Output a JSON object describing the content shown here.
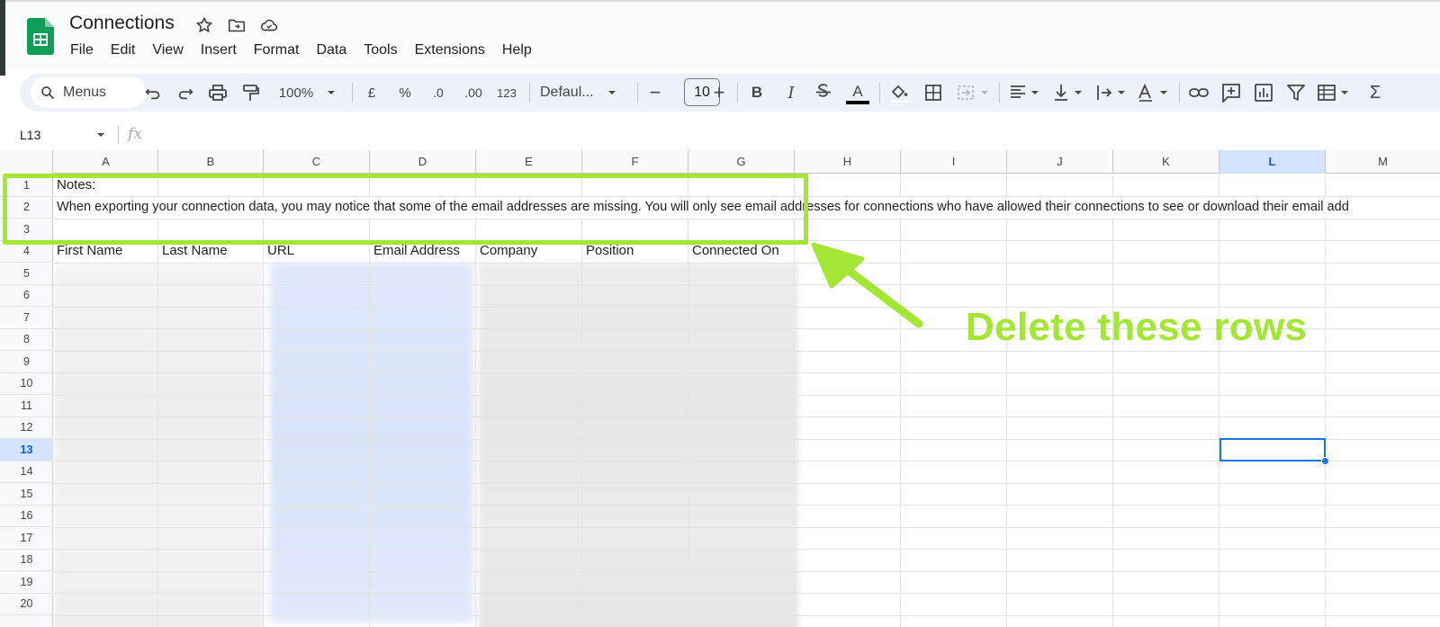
{
  "app": {
    "doc_title": "Connections",
    "icons": [
      "sheets-logo-icon",
      "star-icon",
      "move-folder-icon",
      "cloud-saved-icon"
    ]
  },
  "menu": [
    "File",
    "Edit",
    "View",
    "Insert",
    "Format",
    "Data",
    "Tools",
    "Extensions",
    "Help"
  ],
  "toolbar": {
    "search_label": "Menus",
    "zoom": "100%",
    "currency": "£",
    "percent": "%",
    "decrease_decimal": ".0",
    "increase_decimal": ".00",
    "number_format": "123",
    "font": "Defaul...",
    "font_size": "10",
    "minus": "−",
    "plus": "+",
    "bold": "B",
    "italic": "I",
    "text_color_letter": "A",
    "sum": "Σ"
  },
  "formula_bar": {
    "name_box": "L13",
    "fx": "fx"
  },
  "sheet": {
    "columns": [
      "A",
      "B",
      "C",
      "D",
      "E",
      "F",
      "G",
      "H",
      "I",
      "J",
      "K",
      "L",
      "M"
    ],
    "selected_column": "L",
    "rows": [
      "1",
      "2",
      "3",
      "4",
      "5",
      "6",
      "7",
      "8",
      "9",
      "10",
      "11",
      "12",
      "13",
      "14",
      "15",
      "16",
      "17",
      "18",
      "19",
      "20"
    ],
    "selected_row": "13",
    "notes_label": "Notes:",
    "notes_text": "When exporting your connection data, you may notice that some of the email addresses are missing. You will only see email addresses for connections who have allowed their connections to see or download their email add",
    "headers": [
      "First Name",
      "Last Name",
      "URL",
      "Email Address",
      "Company",
      "Position",
      "Connected On"
    ]
  },
  "annotation": {
    "text": "Delete these rows",
    "color": "#a3e635"
  },
  "colors": {
    "accent": "#1a73e8",
    "sheets_green": "#0f9d58",
    "annotation_green": "#a3e635"
  }
}
